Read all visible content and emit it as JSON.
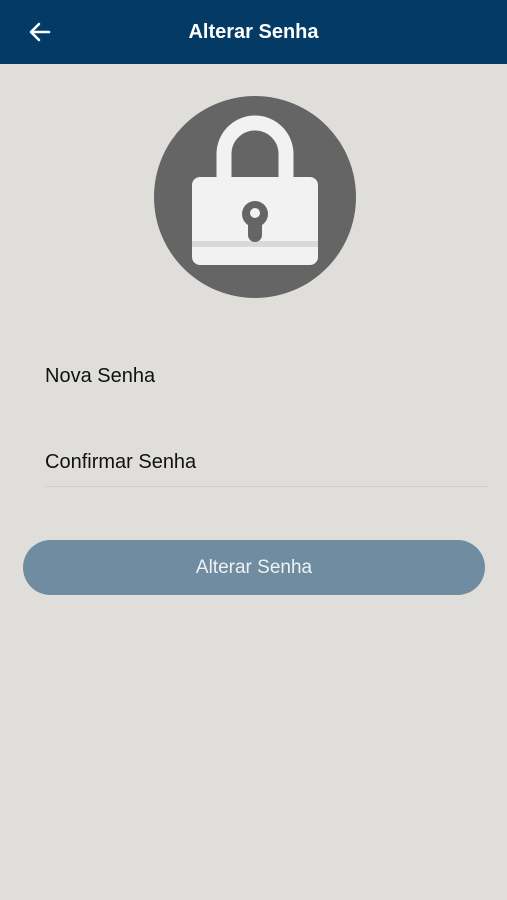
{
  "header": {
    "back_icon": "arrow-left-icon",
    "title": "Alterar Senha"
  },
  "illustration": {
    "icon": "padlock-icon",
    "circle_color": "#656565",
    "lock_color": "#f2f2f2"
  },
  "form": {
    "new_password": {
      "placeholder": "Nova Senha",
      "value": ""
    },
    "confirm_password": {
      "placeholder": "Confirmar Senha",
      "value": ""
    },
    "submit_label": "Alterar Senha"
  },
  "colors": {
    "header_background": "#033a66",
    "page_background": "#dfdedb",
    "button_background": "#6f8ca0"
  }
}
